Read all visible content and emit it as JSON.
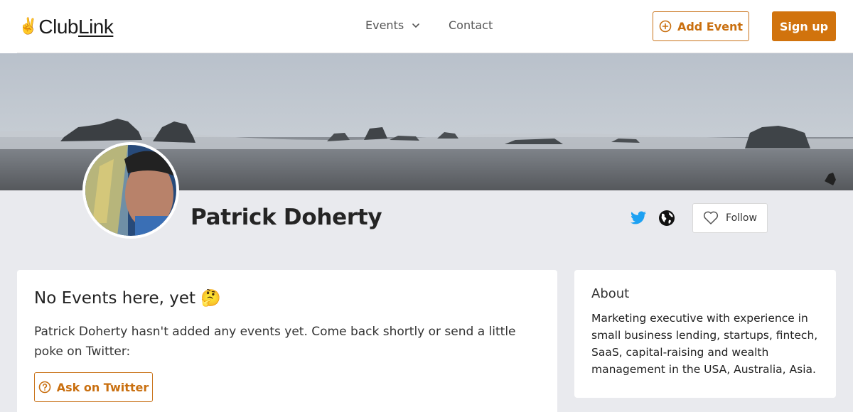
{
  "header": {
    "logo_icon": "victory-hand-icon",
    "logo_part1": "Club",
    "logo_part2": "Link",
    "nav_events": "Events",
    "nav_contact": "Contact",
    "add_event_label": "Add Event",
    "sign_up_label": "Sign up"
  },
  "colors": {
    "accent": "#d1730d",
    "twitter": "#1da1f2",
    "background": "#e9eaee"
  },
  "profile": {
    "name": "Patrick Doherty",
    "follow_label": "Follow"
  },
  "events": {
    "empty_title": "No Events here, yet 🤔",
    "empty_text": "Patrick Doherty hasn't added any events yet. Come back shortly or send a little poke on Twitter:",
    "ask_label": "Ask on Twitter"
  },
  "about": {
    "title": "About",
    "text": "Marketing executive with experience in small business lending, startups, fintech, SaaS, capital-raising and wealth management in the USA, Australia, Asia."
  }
}
